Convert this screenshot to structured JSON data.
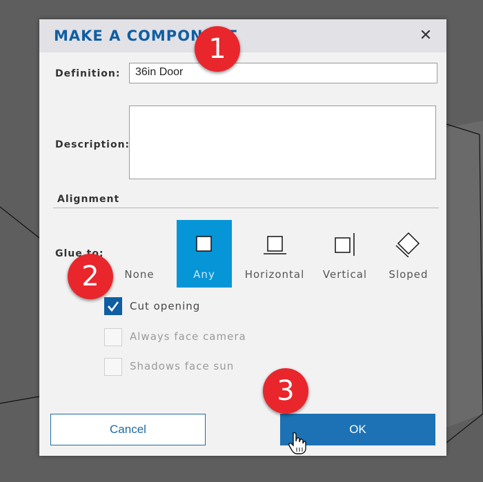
{
  "dialog": {
    "title": "MAKE A COMPONENT",
    "close_icon": "close-icon"
  },
  "form": {
    "definition_label": "Definition:",
    "definition_value": "36in Door",
    "description_label": "Description:",
    "description_value": "",
    "alignment_heading": "Alignment",
    "glue_to_label": "Glue to:"
  },
  "glue_options": [
    {
      "label": "None",
      "icon": "none",
      "selected": false
    },
    {
      "label": "Any",
      "icon": "any-square-icon",
      "selected": true
    },
    {
      "label": "Horizontal",
      "icon": "horizontal-icon",
      "selected": false
    },
    {
      "label": "Vertical",
      "icon": "vertical-icon",
      "selected": false
    },
    {
      "label": "Sloped",
      "icon": "sloped-icon",
      "selected": false
    }
  ],
  "options": [
    {
      "label": "Cut opening",
      "checked": true,
      "enabled": true
    },
    {
      "label": "Always face camera",
      "checked": false,
      "enabled": false
    },
    {
      "label": "Shadows face sun",
      "checked": false,
      "enabled": false
    }
  ],
  "buttons": {
    "cancel": "Cancel",
    "ok": "OK"
  },
  "callouts": [
    "1",
    "2",
    "3"
  ],
  "colors": {
    "accent": "#0f5ea3",
    "selected_tile": "#0695d6",
    "ok_button": "#1c72b4",
    "callout": "#e8262c"
  }
}
